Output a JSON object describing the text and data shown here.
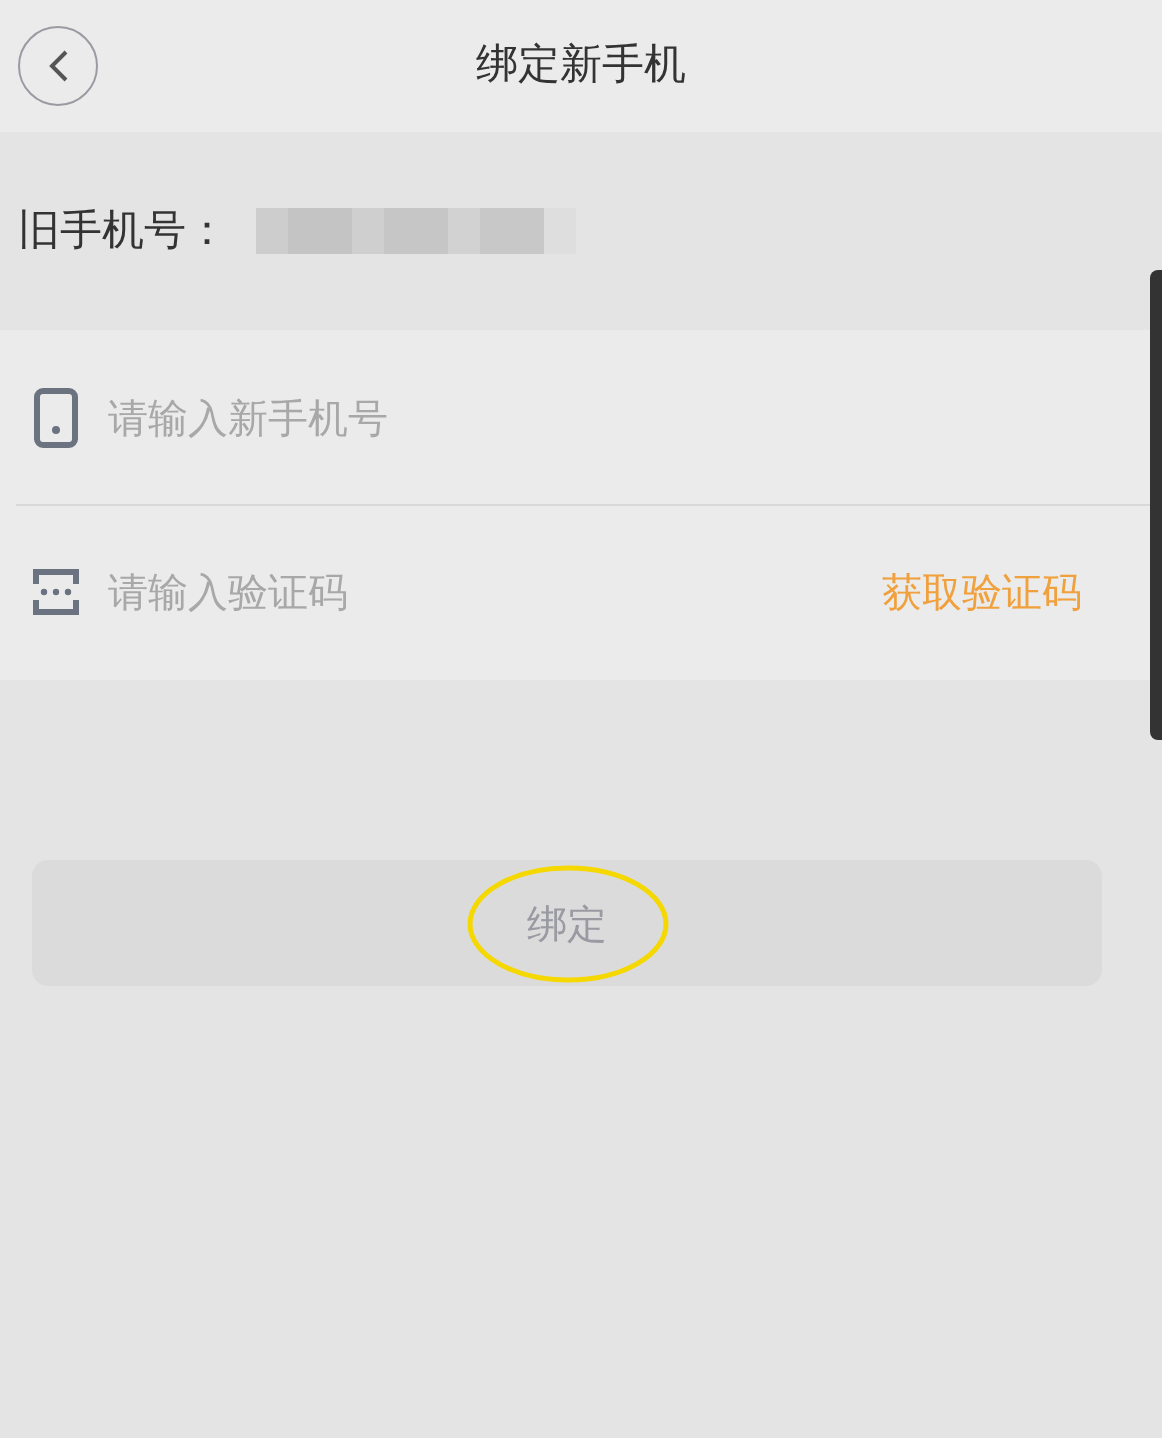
{
  "header": {
    "title": "绑定新手机"
  },
  "old_phone": {
    "label": "旧手机号："
  },
  "fields": [
    {
      "kind": "phone",
      "placeholder": "请输入新手机号"
    },
    {
      "kind": "code",
      "placeholder": "请输入验证码",
      "action": "获取验证码"
    }
  ],
  "submit": {
    "label": "绑定",
    "disabled": true,
    "highlighted": true
  }
}
